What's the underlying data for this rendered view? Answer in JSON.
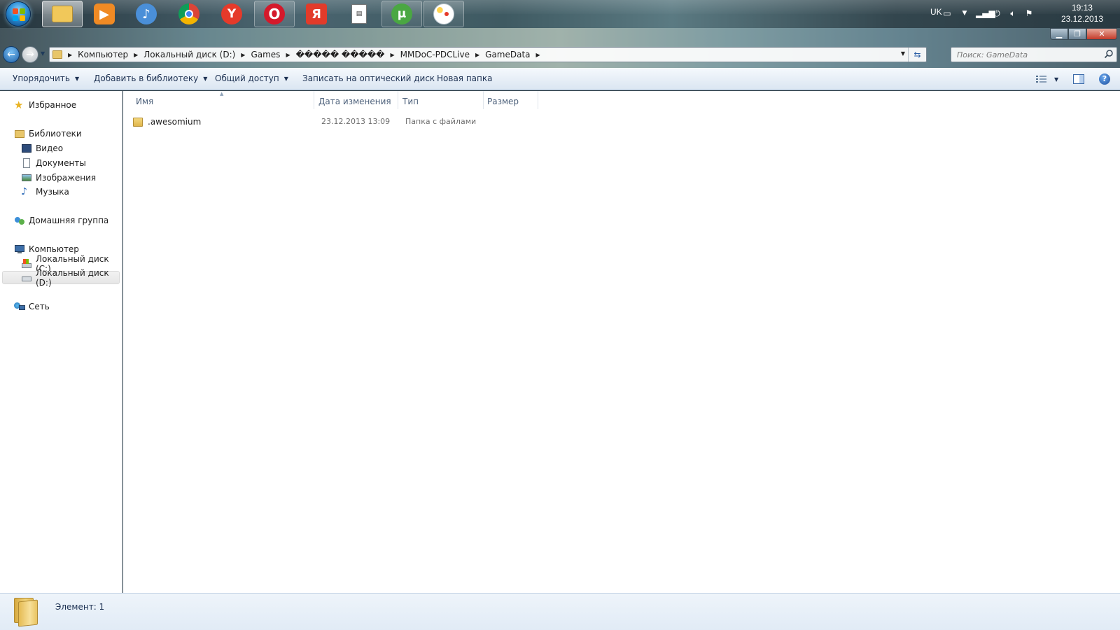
{
  "taskbar": {
    "buttons": [
      {
        "name": "explorer",
        "state": "active",
        "color": "#f1c85a"
      },
      {
        "name": "media-player",
        "state": "plain",
        "color": "#f08a24"
      },
      {
        "name": "volume-app",
        "state": "plain",
        "color": "#4a8fd8"
      },
      {
        "name": "chrome",
        "state": "plain",
        "color": "#3aa35b"
      },
      {
        "name": "yandex-browser",
        "state": "plain",
        "color": "#e53a2a"
      },
      {
        "name": "opera",
        "state": "pinned",
        "color": "#d4192b"
      },
      {
        "name": "yandex",
        "state": "plain",
        "color": "#e23b2a"
      },
      {
        "name": "document-app",
        "state": "plain",
        "color": "#ffffff"
      },
      {
        "name": "utorrent",
        "state": "pinned",
        "color": "#4aa742"
      },
      {
        "name": "paint",
        "state": "pinned",
        "color": "#6fb2e6"
      }
    ],
    "tray": {
      "language": "UK",
      "time": "19:13",
      "date": "23.12.2013"
    }
  },
  "window": {
    "address": {
      "crumbs": [
        "Компьютер",
        "Локальный диск (D:)",
        "Games",
        "����� �����",
        "MMDoC-PDCLive",
        "GameData"
      ]
    },
    "search": {
      "placeholder": "Поиск: GameData"
    }
  },
  "commands": {
    "organize": "Упорядочить",
    "add_to_library": "Добавить в библиотеку",
    "share": "Общий доступ",
    "burn": "Записать на оптический диск",
    "new_folder": "Новая папка"
  },
  "navpane": {
    "favorites": "Избранное",
    "libraries": "Библиотеки",
    "video": "Видео",
    "documents": "Документы",
    "images": "Изображения",
    "music": "Музыка",
    "homegroup": "Домашняя группа",
    "computer": "Компьютер",
    "disk_c": "Локальный диск (C:)",
    "disk_d": "Локальный диск (D:)",
    "network": "Сеть"
  },
  "columns": {
    "name": "Имя",
    "date": "Дата изменения",
    "type": "Тип",
    "size": "Размер"
  },
  "files": [
    {
      "name": ".awesomium",
      "date": "23.12.2013 13:09",
      "type": "Папка с файлами",
      "size": ""
    }
  ],
  "status": {
    "count": "Элемент: 1"
  },
  "colors": {
    "accent": "#1e3253",
    "folder": "#e8c66a",
    "selection": "#e6e6e6"
  }
}
